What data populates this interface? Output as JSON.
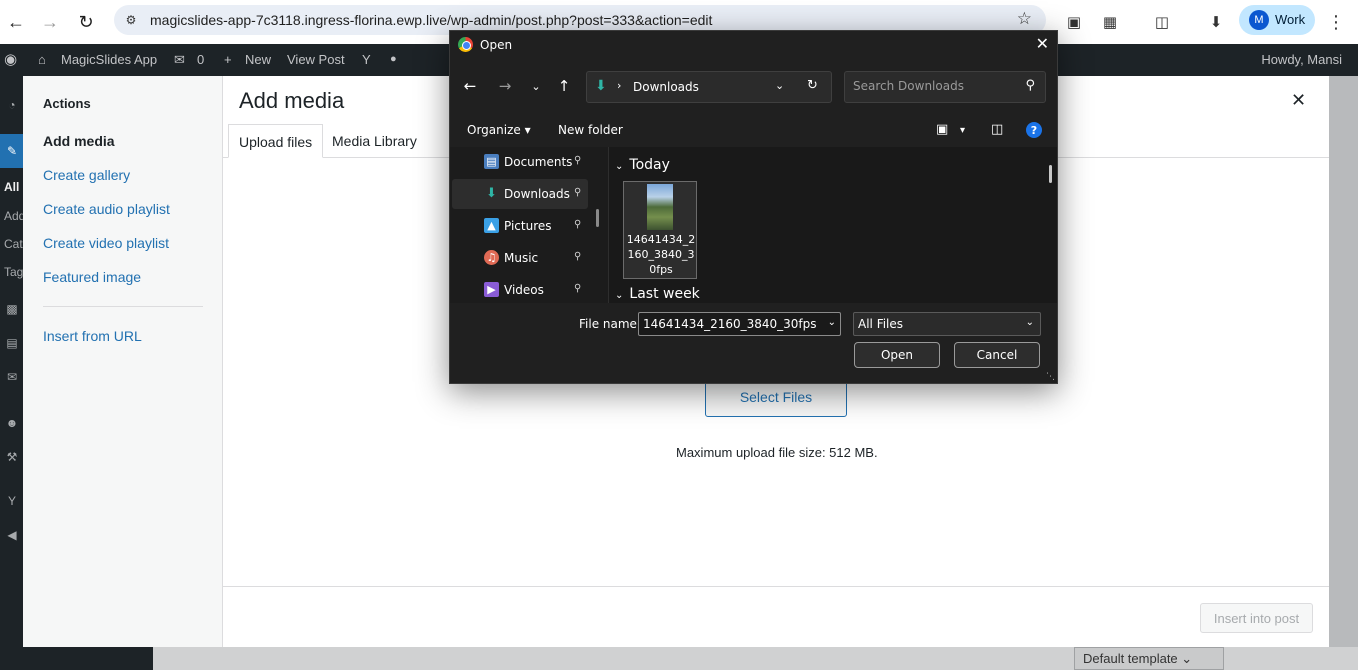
{
  "browser": {
    "url": "magicslides-app-7c3118.ingress-florina.ewp.live/wp-admin/post.php?post=333&action=edit",
    "profile_initial": "M",
    "profile_label": "Work"
  },
  "wp_adminbar": {
    "site_name": "MagicSlides App",
    "comment_count": "0",
    "new_label": "New",
    "view_post": "View Post",
    "howdy": "Howdy, Mansi"
  },
  "wp_sidemenu": {
    "labels": [
      "All",
      "Add",
      "Cat",
      "Tag"
    ]
  },
  "media_modal": {
    "title": "Add media",
    "actions_heading": "Actions",
    "menu": [
      "Add media",
      "Create gallery",
      "Create audio playlist",
      "Create video playlist",
      "Featured image"
    ],
    "insert_from_url": "Insert from URL",
    "tabs": [
      "Upload files",
      "Media Library"
    ],
    "select_files": "Select Files",
    "max_upload": "Maximum upload file size: 512 MB.",
    "insert_button": "Insert into post"
  },
  "editor": {
    "template_select": "Default template"
  },
  "open_dialog": {
    "title": "Open",
    "location": "Downloads",
    "search_placeholder": "Search Downloads",
    "organize": "Organize",
    "new_folder": "New folder",
    "nav_items": [
      {
        "label": "Documents",
        "icon": "document-icon",
        "color": "#4a7ebf"
      },
      {
        "label": "Downloads",
        "icon": "download-icon",
        "color": "#2fb5a6"
      },
      {
        "label": "Pictures",
        "icon": "picture-icon",
        "color": "#3aa0e6"
      },
      {
        "label": "Music",
        "icon": "music-icon",
        "color": "#e06a55"
      },
      {
        "label": "Videos",
        "icon": "video-icon",
        "color": "#8a5cd6"
      }
    ],
    "group_today": "Today",
    "group_last_week": "Last week",
    "file_name": "14641434_2160_3840_30fps",
    "file_name_label": "File name:",
    "file_type": "All Files",
    "open_button": "Open",
    "cancel_button": "Cancel"
  }
}
